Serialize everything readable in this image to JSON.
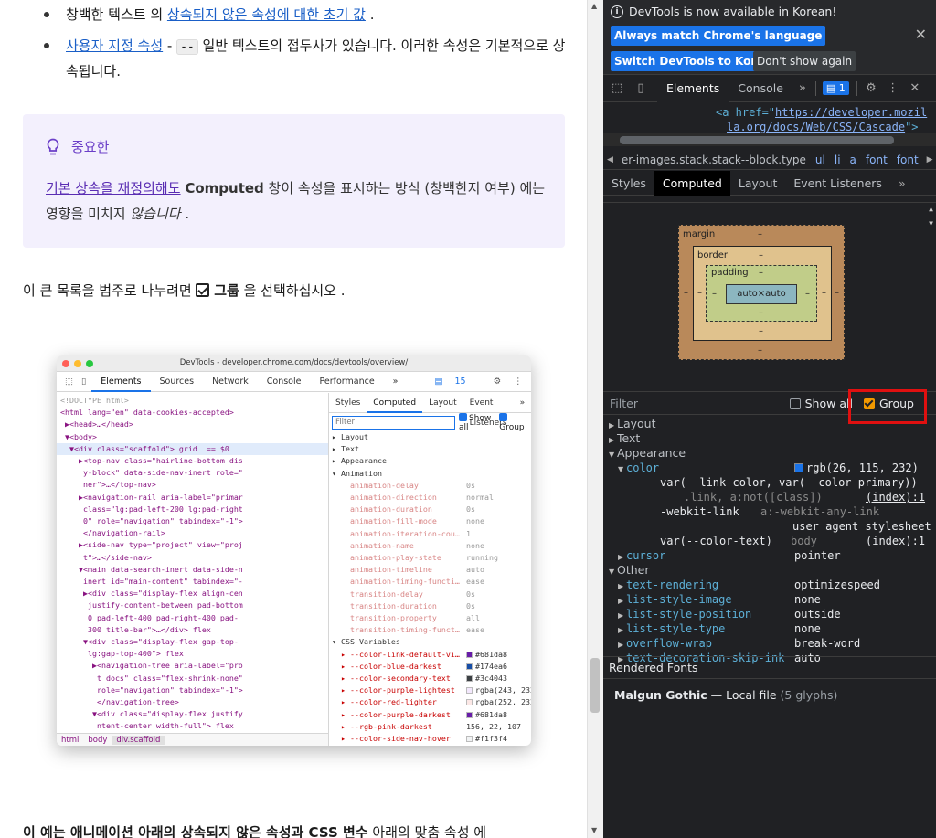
{
  "article": {
    "bullet1_pre": "창백한 텍스트 의 ",
    "bullet1_link": "상속되지 않은 속성에 대한 초기 값",
    "bullet1_post": " .",
    "bullet2_link": "사용자 지정 속성",
    "bullet2_mid": " - ",
    "bullet2_code": "--",
    "bullet2_post": " 일반 텍스트의 접두사가 있습니다. 이러한 속성은 기본적으로 상속됩니다.",
    "note_title": "중요한",
    "note_link": "기본 상속을 재정의해도",
    "note_bold": "Computed",
    "note_text": " 창이 속성을 표시하는 방식 (창백한지 여부) 에는 영향을 미치지 ",
    "note_em": "않습니다",
    "note_end": " .",
    "group_pre": "이 큰 목록을 범주로 나누려면 ",
    "group_bold": "그룹",
    "group_post": " 을 선택하십시오 .",
    "footer_bold1": "이 예는 애니메이션 아래의 상속되지 않은 속성과 CSS 변수",
    "footer_rest": " 아래의 맞춤 속성 에"
  },
  "screenshot": {
    "title": "DevTools - developer.chrome.com/docs/devtools/overview/",
    "tabs": [
      "Elements",
      "Sources",
      "Network",
      "Console",
      "Performance",
      "»"
    ],
    "issues": "15",
    "dom_lines": [
      "<!DOCTYPE html>",
      "<html lang=\"en\" data-cookies-accepted>",
      " ▶<head>…</head>",
      " ▼<body>",
      "  ▼<div class=\"scaffold\"> grid  == $0",
      "    ▶<top-nav class=\"hairline-bottom dis",
      "     y-block\" data-side-nav-inert role=\"",
      "     ner\">…</top-nav>",
      "    ▶<navigation-rail aria-label=\"primar",
      "     class=\"lg:pad-left-200 lg:pad-right",
      "     0\" role=\"navigation\" tabindex=\"-1\">",
      "     </navigation-rail>",
      "    ▶<side-nav type=\"project\" view=\"proj",
      "     t\">…</side-nav>",
      "    ▼<main data-search-inert data-side-n",
      "     inert id=\"main-content\" tabindex=\"-",
      "     ▶<div class=\"display-flex align-cen",
      "      justify-content-between pad-bottom",
      "      0 pad-left-400 pad-right-400 pad-",
      "      300 title-bar\">…</div> flex",
      "     ▼<div class=\"display-flex gap-top-",
      "      lg:gap-top-400\"> flex",
      "       ▶<navigation-tree aria-label=\"pro",
      "        t docs\" class=\"flex-shrink-none\"",
      "        role=\"navigation\" tabindex=\"-1\">",
      "        </navigation-tree>",
      "       ▼<div class=\"display-flex justify",
      "        ntent-center width-full\"> flex"
    ],
    "crumbs": [
      "html",
      "body",
      "div.scaffold"
    ],
    "right_tabs": [
      "Styles",
      "Computed",
      "Layout",
      "Event Listeners",
      "»"
    ],
    "filter_placeholder": "Filter",
    "show_all": "Show all",
    "group": "Group",
    "groups": [
      "Layout",
      "Text",
      "Appearance",
      "Animation"
    ],
    "anim_props": [
      {
        "n": "animation-delay",
        "v": "0s"
      },
      {
        "n": "animation-direction",
        "v": "normal"
      },
      {
        "n": "animation-duration",
        "v": "0s"
      },
      {
        "n": "animation-fill-mode",
        "v": "none"
      },
      {
        "n": "animation-iteration-cou…",
        "v": "1"
      },
      {
        "n": "animation-name",
        "v": "none"
      },
      {
        "n": "animation-play-state",
        "v": "running"
      },
      {
        "n": "animation-timeline",
        "v": "auto"
      },
      {
        "n": "animation-timing-functi…",
        "v": "ease"
      },
      {
        "n": "transition-delay",
        "v": "0s"
      },
      {
        "n": "transition-duration",
        "v": "0s"
      },
      {
        "n": "transition-property",
        "v": "all"
      },
      {
        "n": "transition-timing-funct…",
        "v": "ease"
      }
    ],
    "css_vars_label": "CSS Variables",
    "css_vars": [
      {
        "n": "--color-link-default-vi…",
        "v": "#681da8",
        "c": "#681da8"
      },
      {
        "n": "--color-blue-darkest",
        "v": "#174ea6",
        "c": "#174ea6"
      },
      {
        "n": "--color-secondary-text",
        "v": "#3c4043",
        "c": "#3c4043"
      },
      {
        "n": "--color-purple-lightest",
        "v": "rgba(243, 232, 253,",
        "c": "#f3e8fd"
      },
      {
        "n": "--color-red-lighter",
        "v": "rgba(252, 232, 230,",
        "c": "#fce8e6"
      },
      {
        "n": "--color-purple-darkest",
        "v": "#681da8",
        "c": "#681da8"
      },
      {
        "n": "--rgb-pink-darkest",
        "v": "156, 22, 107",
        "c": ""
      },
      {
        "n": "--color-side-nav-hover",
        "v": "#f1f3f4",
        "c": "#f1f3f4"
      }
    ]
  },
  "devtools": {
    "info_msg": "DevTools is now available in Korean!",
    "btn_match": "Always match Chrome's language",
    "btn_switch": "Switch DevTools to Korean",
    "btn_dont": "Don't show again",
    "tab_elements": "Elements",
    "tab_console": "Console",
    "issues_count": "1",
    "src_line1_pre": "<a href=\"",
    "src_line1_link": "https://developer.mozil",
    "src_line2": "la.org/docs/Web/CSS/Cascade",
    "src_line2_end": "\">",
    "crumb_items": [
      "er-images.stack.stack--block.type",
      "ul",
      "li",
      "a",
      "font",
      "font"
    ],
    "sub_tabs": [
      "Styles",
      "Computed",
      "Layout",
      "Event Listeners"
    ],
    "bm_margin": "margin",
    "bm_border": "border",
    "bm_padding": "padding",
    "bm_content": "auto×auto",
    "bm_dash": "–",
    "filter_label": "Filter",
    "show_all": "Show all",
    "group": "Group",
    "cat_layout": "Layout",
    "cat_text": "Text",
    "cat_appearance": "Appearance",
    "color_name": "color",
    "color_value": "rgb(26, 115, 232)",
    "color_swatch": "#1a73e8",
    "var_line": "var(--link-color, var(--color-primary))",
    "sel_line": ".link, a:not([class])",
    "idx1": "(index):1",
    "webkit_link": "-webkit-link",
    "webkit_sel": "a:-webkit-any-link",
    "ua_sheet": "user agent stylesheet",
    "var_text": "var(--color-text)",
    "body_sel": "body",
    "idx2": "(index):1",
    "cursor_name": "cursor",
    "cursor_value": "pointer",
    "cat_other": "Other",
    "other_props": [
      {
        "n": "text-rendering",
        "v": "optimizespeed"
      },
      {
        "n": "list-style-image",
        "v": "none"
      },
      {
        "n": "list-style-position",
        "v": "outside"
      },
      {
        "n": "list-style-type",
        "v": "none"
      },
      {
        "n": "overflow-wrap",
        "v": "break-word"
      },
      {
        "n": "text-decoration-skip-ink",
        "v": "auto"
      }
    ],
    "rendered_fonts": "Rendered Fonts",
    "font_name": "Malgun Gothic",
    "font_dash": " — ",
    "font_src": "Local file",
    "font_glyphs": "(5 glyphs)"
  }
}
